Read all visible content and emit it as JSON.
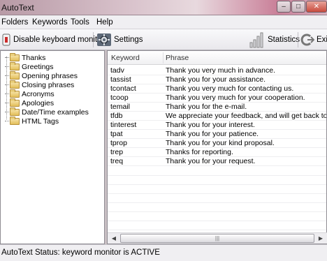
{
  "window": {
    "title": "AutoText"
  },
  "window_buttons": {
    "minimize": "–",
    "maximize": "□",
    "close": "✕"
  },
  "menu": [
    "Folders",
    "Keywords",
    "Tools",
    "Help"
  ],
  "toolbar": {
    "disable_label": "Disable keyboard monitor",
    "settings_label": "Settings",
    "statistics_label": "Statistics",
    "exit_label": "Exi"
  },
  "tree": {
    "items": [
      "Thanks",
      "Greetings",
      "Opening phrases",
      "Closing phrases",
      "Acronyms",
      "Apologies",
      "Date/Time examples",
      "HTML Tags"
    ]
  },
  "list": {
    "columns": {
      "keyword": "Keyword",
      "phrase": "Phrase"
    },
    "rows": [
      {
        "keyword": "tadv",
        "phrase": "Thank you very much in advance."
      },
      {
        "keyword": "tassist",
        "phrase": "Thank you for your assistance."
      },
      {
        "keyword": "tcontact",
        "phrase": "Thank you very much for contacting us."
      },
      {
        "keyword": "tcoop",
        "phrase": "Thank you very much for your cooperation."
      },
      {
        "keyword": "temail",
        "phrase": "Thank you for the e-mail."
      },
      {
        "keyword": "tfdb",
        "phrase": "We appreciate your feedback, and will get back to you as soon"
      },
      {
        "keyword": "tinterest",
        "phrase": "Thank you for your interest."
      },
      {
        "keyword": "tpat",
        "phrase": "Thank you for your patience."
      },
      {
        "keyword": "tprop",
        "phrase": "Thank you for your kind proposal."
      },
      {
        "keyword": "trep",
        "phrase": "Thanks for reporting."
      },
      {
        "keyword": "treq",
        "phrase": "Thank you for your request."
      }
    ]
  },
  "scrollbar": {
    "grip": "|||"
  },
  "status": {
    "text": "AutoText Status: keyword monitor is ACTIVE"
  }
}
